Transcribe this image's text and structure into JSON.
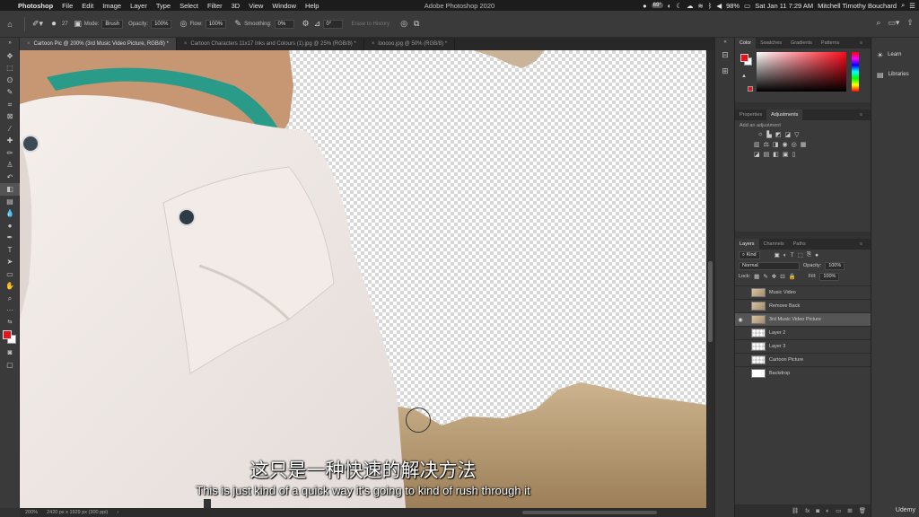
{
  "menubar": {
    "app": "Photoshop",
    "menus": [
      "File",
      "Edit",
      "Image",
      "Layer",
      "Type",
      "Select",
      "Filter",
      "3D",
      "View",
      "Window",
      "Help"
    ],
    "window_title": "Adobe Photoshop 2020",
    "temp_badge": "69°",
    "battery": "98%",
    "datetime": "Sat Jan 11  7:29 AM",
    "user": "Mitchell Timothy Bouchard"
  },
  "options": {
    "brush_size": "27",
    "mode_label": "Mode:",
    "mode_value": "Brush",
    "opacity_label": "Opacity:",
    "opacity_value": "100%",
    "flow_label": "Flow:",
    "flow_value": "100%",
    "smoothing_label": "Smoothing:",
    "smoothing_value": "0%",
    "angle_value": "0°",
    "erase_history_label": "Erase to History"
  },
  "tabs": [
    {
      "label": "Cartoon Pic @ 200% (3rd Music Video Picture, RGB/8) *"
    },
    {
      "label": "Cartoon Characters 11x17 Inks and Colours (1).jpg @ 25% (RGB/8) *"
    },
    {
      "label": "looooo.jpg @ 50% (RGB/8) *"
    }
  ],
  "status": {
    "zoom": "200%",
    "doc_info": "2420 px x 1929 px (300 ppi)"
  },
  "subtitles": {
    "chinese": "这只是一种快速的解决方法",
    "english": "This is just kind of a quick way it's going to kind of rush through it"
  },
  "color_panel": {
    "tabs": [
      "Color",
      "Swatches",
      "Gradients",
      "Patterns"
    ],
    "foreground": "#e3141d",
    "background": "#ffffff"
  },
  "adjustments_panel": {
    "tabs": [
      "Properties",
      "Adjustments"
    ],
    "hint": "Add an adjustment"
  },
  "layers_panel": {
    "tabs": [
      "Layers",
      "Channels",
      "Paths"
    ],
    "filter_kind": "Kind",
    "blend_mode": "Normal",
    "opacity_label": "Opacity:",
    "opacity_value": "100%",
    "lock_label": "Lock:",
    "fill_label": "Fill:",
    "fill_value": "100%",
    "layers": [
      {
        "name": "Music Video",
        "visible": false,
        "selected": false,
        "thumb": "photo"
      },
      {
        "name": "Remove Back",
        "visible": false,
        "selected": false,
        "thumb": "photo"
      },
      {
        "name": "3rd Music Video Picture",
        "visible": true,
        "selected": true,
        "thumb": "photo"
      },
      {
        "name": "Layer 2",
        "visible": false,
        "selected": false,
        "thumb": "checker"
      },
      {
        "name": "Layer 3",
        "visible": false,
        "selected": false,
        "thumb": "checker"
      },
      {
        "name": "Cartoon Picture",
        "visible": false,
        "selected": false,
        "thumb": "checker"
      },
      {
        "name": "Backdrop",
        "visible": false,
        "selected": false,
        "thumb": "white"
      }
    ]
  },
  "learn_panel": {
    "items": [
      "Learn",
      "Libraries"
    ]
  },
  "watermark": "Udemy"
}
